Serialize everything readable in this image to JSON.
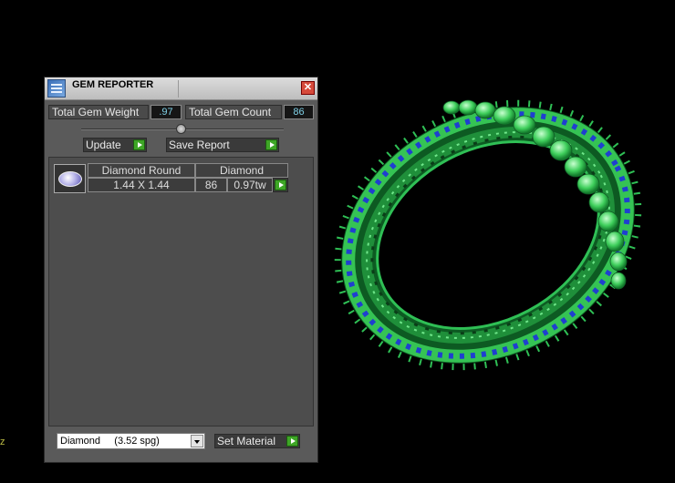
{
  "window": {
    "title": "GEM REPORTER",
    "close_glyph": "✕"
  },
  "stats": {
    "total_gem_weight_label": "Total Gem Weight",
    "total_gem_weight_value": ".97",
    "total_gem_count_label": "Total Gem Count",
    "total_gem_count_value": "86"
  },
  "buttons": {
    "update": "Update",
    "save_report": "Save Report",
    "set_material": "Set Material"
  },
  "gem_table": {
    "columns": [
      "Diamond Round",
      "Diamond"
    ],
    "rows": [
      {
        "size": "1.44 X 1.44",
        "count": "86",
        "weight": "0.97tw"
      }
    ]
  },
  "material_select": {
    "selected": "Diamond     (3.52 spg)"
  },
  "colors": {
    "ring_green": "#2fbf55",
    "gem_blue": "#1f3fd0",
    "go_green": "#3ea626",
    "value_text": "#7fd0e6"
  },
  "icons": [
    "app-icon",
    "close-icon",
    "gem-thumbnail-icon",
    "go-arrow-icon",
    "dropdown-arrow-icon",
    "slider-grip-icon"
  ],
  "stray_text": "z"
}
